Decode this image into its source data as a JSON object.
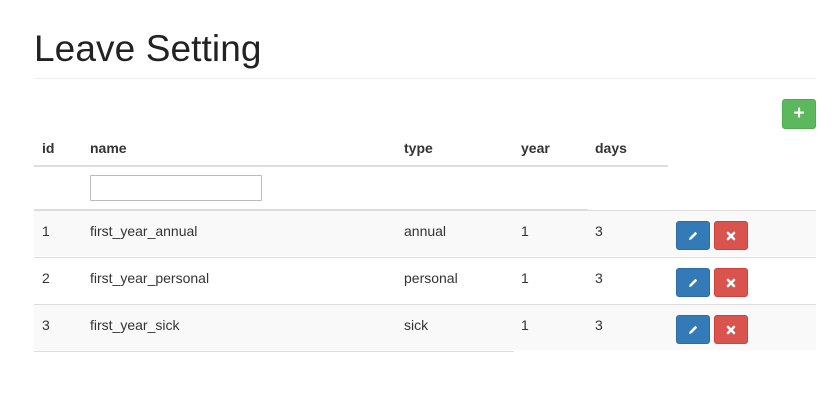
{
  "page": {
    "title": "Leave Setting"
  },
  "toolbar": {
    "add_icon": "plus-icon",
    "add_color": "#5cb85c"
  },
  "table": {
    "columns": [
      "id",
      "name",
      "type",
      "year",
      "days"
    ],
    "filter": {
      "name_value": "",
      "name_placeholder": ""
    },
    "rows": [
      {
        "id": "1",
        "name": "first_year_annual",
        "type": "annual",
        "year": "1",
        "days": "3"
      },
      {
        "id": "2",
        "name": "first_year_personal",
        "type": "personal",
        "year": "1",
        "days": "3"
      },
      {
        "id": "3",
        "name": "first_year_sick",
        "type": "sick",
        "year": "1",
        "days": "3"
      }
    ],
    "row_actions": {
      "edit_icon": "pencil-icon",
      "edit_color": "#337ab7",
      "delete_icon": "close-icon",
      "delete_color": "#d9534f"
    }
  }
}
